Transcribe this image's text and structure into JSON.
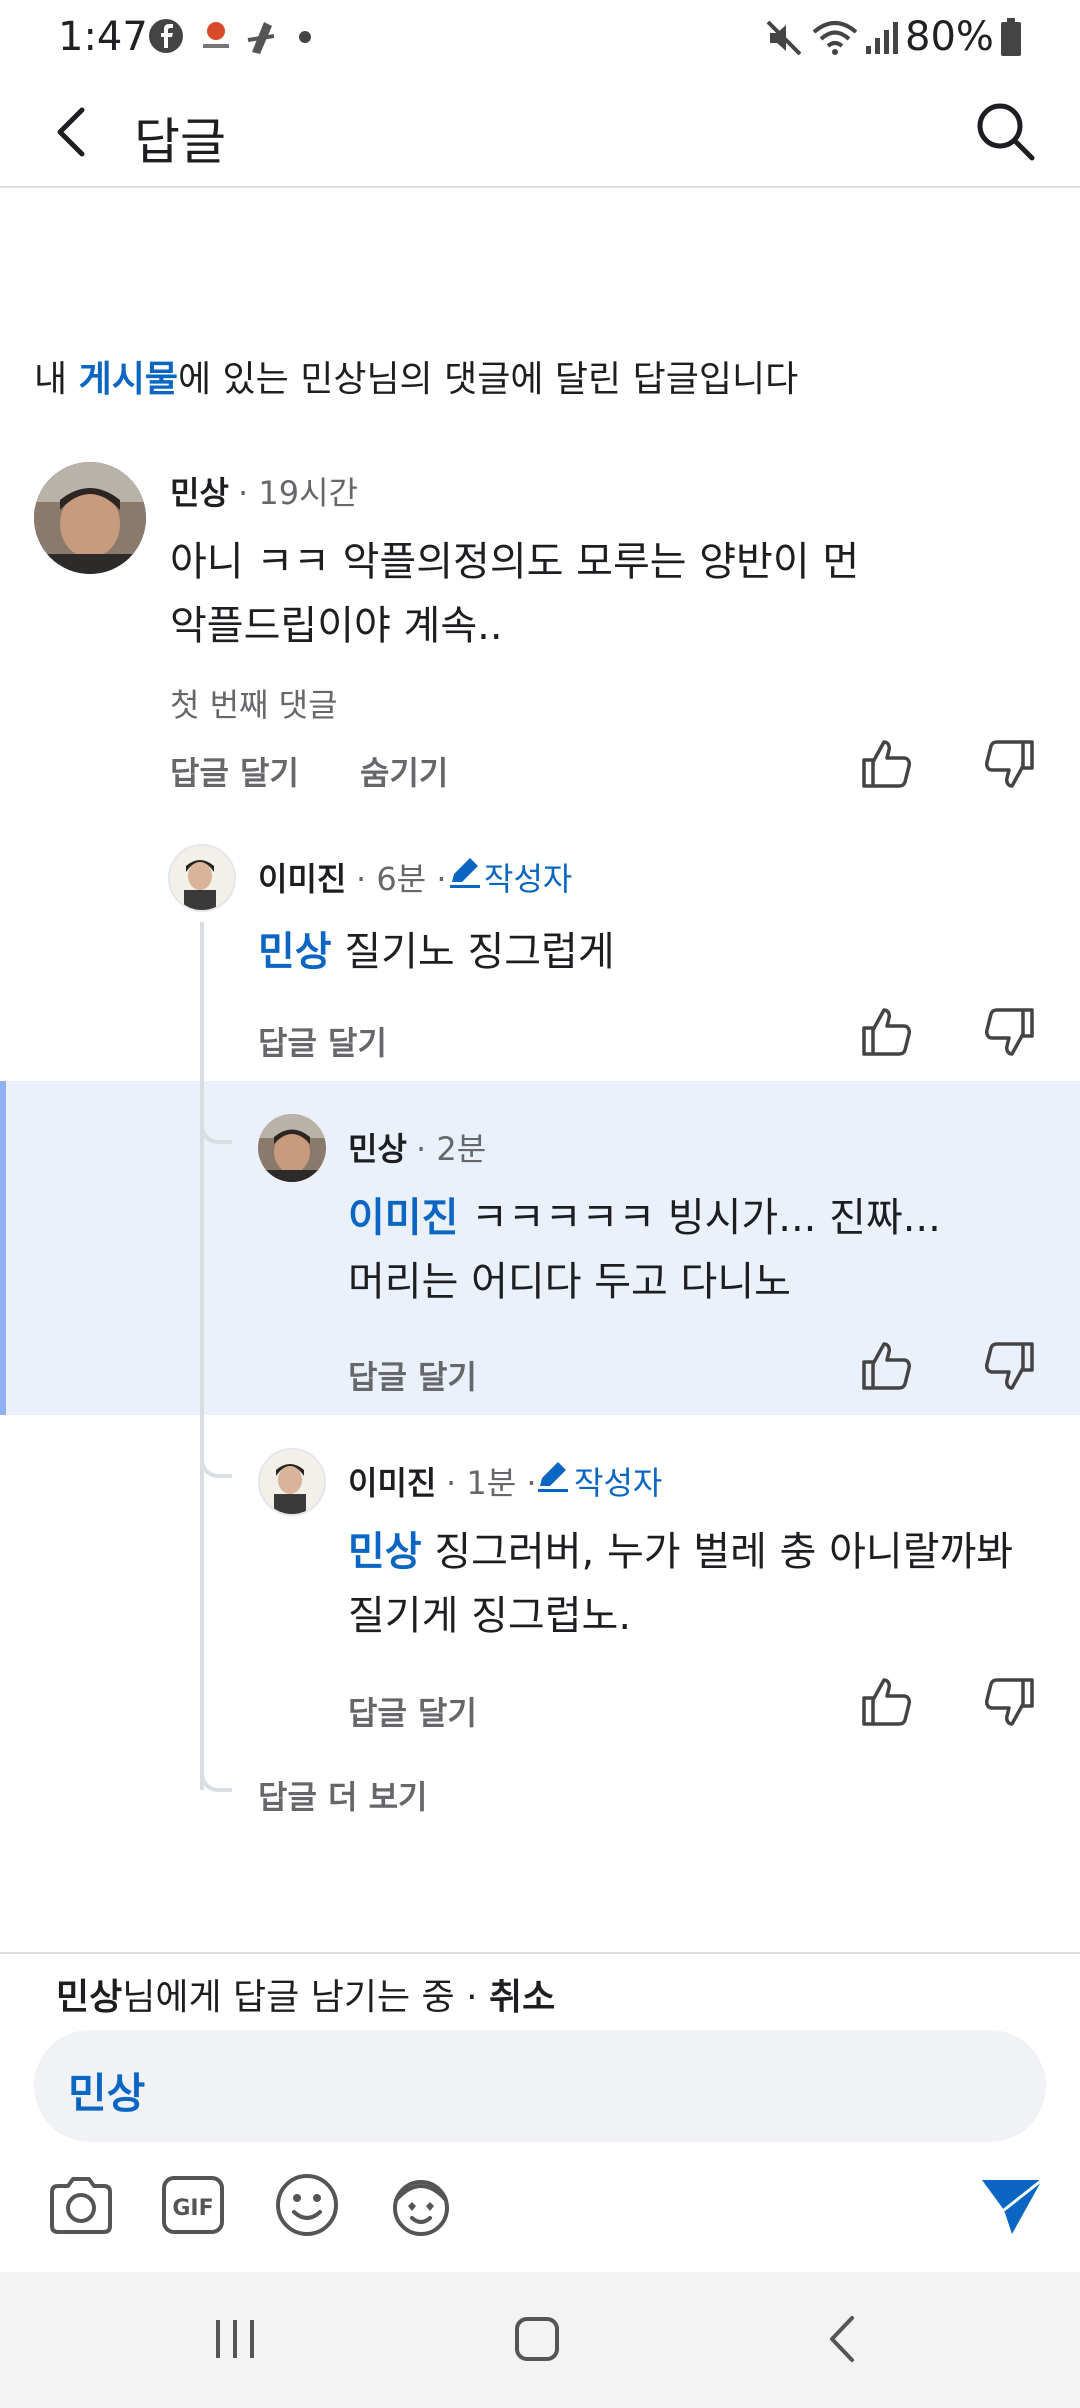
{
  "status_bar": {
    "time": "1:47",
    "battery_percent": "80%",
    "icons": [
      "facebook-icon",
      "app-icon",
      "app-icon",
      "dot-icon",
      "mute-icon",
      "wifi-icon",
      "signal-icon",
      "battery-icon"
    ]
  },
  "header": {
    "title": "답글",
    "icons": [
      "back-arrow-icon",
      "search-icon"
    ]
  },
  "context": {
    "prefix": "내 ",
    "link": "게시물",
    "suffix": "에 있는 민상님의 댓글에 달린 답글입니다"
  },
  "comment": {
    "author": "민상",
    "time": "· 19시간",
    "lines": [
      "아니 ㅋㅋ 악플의정의도 모루는 양반이 먼",
      "악플드립이야 계속.."
    ],
    "badge": "첫 번째 댓글",
    "actions": {
      "reply": "답글 달기",
      "hide": "숨기기"
    }
  },
  "replies": [
    {
      "author": "이미진",
      "time": "· 6분 ·",
      "author_badge": "작성자",
      "mention": "민상",
      "lines": [
        " 질기노 징그럽게"
      ],
      "reply_label": "답글 달기"
    },
    {
      "author": "민상",
      "time": "· 2분",
      "mention": "이미진",
      "lines": [
        " ㅋㅋㅋㅋㅋ 빙시가... 진짜...",
        "머리는 어디다 두고 다니노"
      ],
      "reply_label": "답글 달기",
      "highlighted": true
    },
    {
      "author": "이미진",
      "time": "· 1분 ·",
      "author_badge": "작성자",
      "mention": "민상",
      "lines": [
        " 징그러버, 누가 벌레 충 아니랄까봐",
        "질기게 징그럽노."
      ],
      "reply_label": "답글 달기"
    }
  ],
  "more_replies": "답글 더 보기",
  "reply_bar": {
    "target": "민상",
    "text": "님에게 답글 남기는 중 · ",
    "cancel": "취소",
    "input_value": "민상",
    "tools": [
      "camera-icon",
      "gif-icon",
      "emoji-icon",
      "avatar-sticker-icon",
      "send-icon"
    ]
  },
  "nav_bar": {
    "icons": [
      "recent-apps-icon",
      "home-icon",
      "back-icon"
    ]
  },
  "colors": {
    "accent": "#0a66c2",
    "highlight": "#ebf1fb",
    "muted": "#65676b"
  }
}
